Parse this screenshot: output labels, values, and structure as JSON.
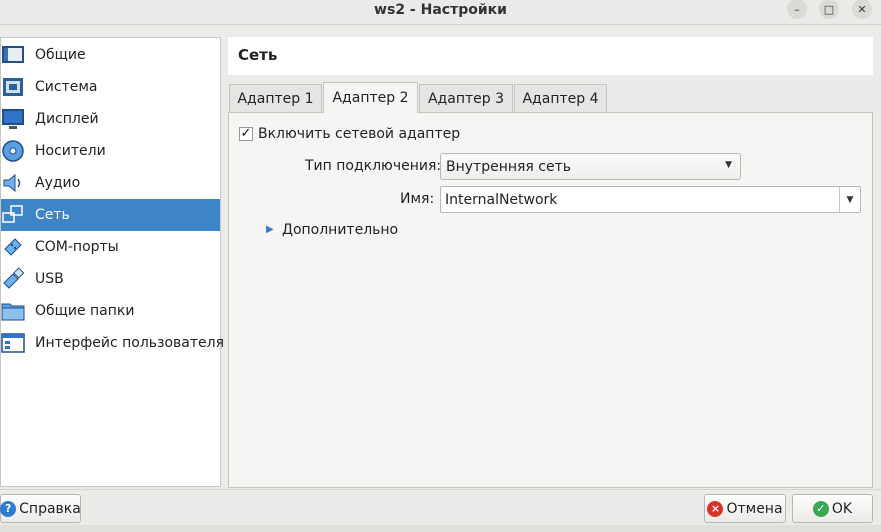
{
  "window": {
    "title": "ws2 - Настройки",
    "minimize_glyph": "–",
    "maximize_glyph": "□",
    "close_glyph": "✕"
  },
  "sidebar": {
    "items": [
      {
        "label": "Общие",
        "icon": "general-icon",
        "selected": false
      },
      {
        "label": "Система",
        "icon": "system-icon",
        "selected": false
      },
      {
        "label": "Дисплей",
        "icon": "display-icon",
        "selected": false
      },
      {
        "label": "Носители",
        "icon": "storage-icon",
        "selected": false
      },
      {
        "label": "Аудио",
        "icon": "audio-icon",
        "selected": false
      },
      {
        "label": "Сеть",
        "icon": "network-icon",
        "selected": true
      },
      {
        "label": "COM-порты",
        "icon": "serial-ports-icon",
        "selected": false
      },
      {
        "label": "USB",
        "icon": "usb-icon",
        "selected": false
      },
      {
        "label": "Общие папки",
        "icon": "shared-folders-icon",
        "selected": false
      },
      {
        "label": "Интерфейс пользователя",
        "icon": "user-interface-icon",
        "selected": false
      }
    ]
  },
  "page": {
    "title": "Сеть"
  },
  "tabs": [
    {
      "label": "Адаптер 1",
      "active": false
    },
    {
      "label": "Адаптер 2",
      "active": true
    },
    {
      "label": "Адаптер 3",
      "active": false
    },
    {
      "label": "Адаптер 4",
      "active": false
    }
  ],
  "adapter": {
    "enable_label": "Включить сетевой адаптер",
    "enable_checked": true,
    "check_glyph": "✓",
    "attached_to_label": "Тип подключения:",
    "attached_to_value": "Внутренняя сеть",
    "name_label": "Имя:",
    "name_value": "InternalNetwork",
    "advanced_label": "Дополнительно"
  },
  "buttons": {
    "help": "Справка",
    "cancel": "Отмена",
    "ok": "OK"
  },
  "colors": {
    "selection": "#3d85c6",
    "accent_icon": "#2e7bd0",
    "cancel_icon": "#d9342b",
    "ok_icon": "#3aa657"
  }
}
